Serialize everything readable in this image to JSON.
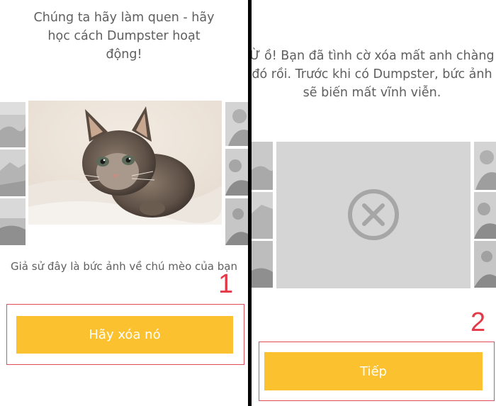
{
  "left_panel": {
    "heading_lines": [
      "Chúng ta hãy làm quen - hãy",
      "học cách Dumpster hoạt",
      "động!"
    ],
    "caption": "Giả sử đây là bức ảnh về chú mèo của bạn",
    "delete_button_label": "Hãy xóa nó",
    "step_number": "1",
    "photo_icon": "kitten-photo"
  },
  "right_panel": {
    "heading_lines": [
      "Ừ ồ! Bạn đã tình cờ xóa mất anh chàng",
      "đó rồi. Trước khi có Dumpster, bức ảnh",
      "sẽ biến mất vĩnh viễn."
    ],
    "next_button_label": "Tiếp",
    "step_number": "2",
    "deleted_icon": "close-circle-icon"
  },
  "colors": {
    "button": "#fbc12e",
    "annotation": "#e53947",
    "heading_text": "#5f5f5f",
    "placeholder": "#d5d5d5"
  }
}
